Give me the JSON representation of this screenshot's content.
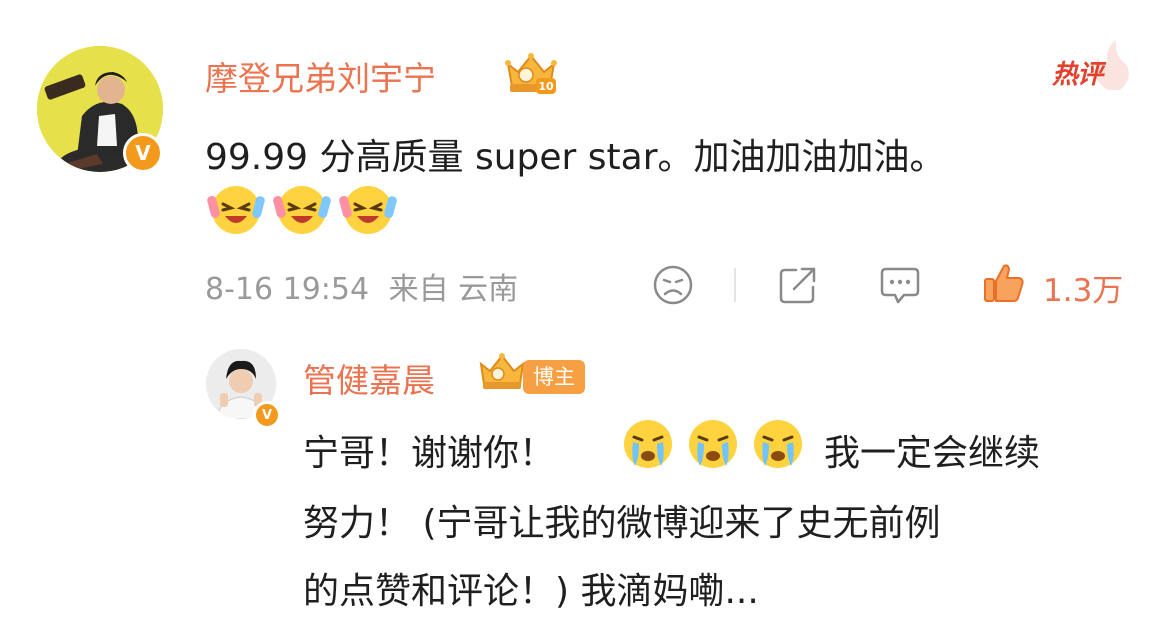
{
  "main_comment": {
    "username": "摩登兄弟刘宇宁",
    "verified_mark": "V",
    "text": "99.99 分高质量 super star。加油加油加油。",
    "emojis": [
      "laugh-cry-emoji",
      "laugh-cry-emoji",
      "laugh-cry-emoji"
    ],
    "hot_label": "热评",
    "time": "8-16 19:54",
    "source": "来自 云南",
    "like_count": "1.3万",
    "icons": [
      "dislike-face-icon",
      "share-icon",
      "comment-icon",
      "thumbs-up-icon"
    ],
    "crown_level": "10"
  },
  "reply": {
    "username": "管健嘉晨",
    "verified_mark": "V",
    "host_tag": "博主",
    "line1_a": "宁哥！谢谢你！",
    "line1_emojis": [
      "crying-emoji",
      "crying-emoji",
      "crying-emoji"
    ],
    "line1_b": "我一定会继续",
    "line2": "努力！ (宁哥让我的微博迎来了史无前例",
    "line3": "的点赞和评论！) 我滴妈嘞..."
  },
  "colors": {
    "accent": "#eb7350",
    "hot": "#e2422c",
    "meta": "#9a9a9a",
    "text": "#1f1f1f"
  }
}
